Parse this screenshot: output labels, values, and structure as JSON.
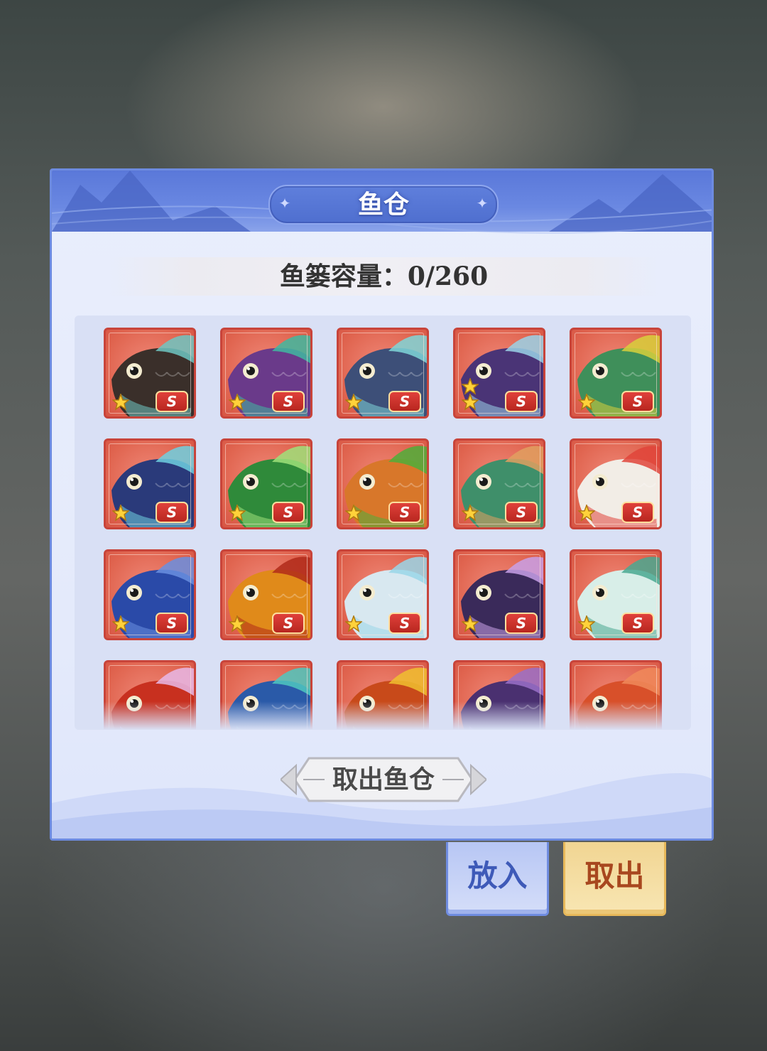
{
  "panel": {
    "title": "鱼仓",
    "capacity_text": "鱼篓容量：0/260",
    "take_storage_label": "取出鱼仓"
  },
  "actions": {
    "put_in_label": "放入",
    "take_out_label": "取出"
  },
  "fish_slots": [
    {
      "species": "black-dragon-fish",
      "body": "#3a2f2a",
      "accent": "#6fc6c2",
      "stars": 1,
      "badge": "S"
    },
    {
      "species": "purple-fish",
      "body": "#6a3a8a",
      "accent": "#3fb8a0",
      "stars": 1,
      "badge": "S"
    },
    {
      "species": "blue-spiky-fish",
      "body": "#3d4f78",
      "accent": "#7fd6d8",
      "stars": 1,
      "badge": "S"
    },
    {
      "species": "dark-purple-fish",
      "body": "#4a3476",
      "accent": "#9ad2e8",
      "stars": 2,
      "badge": "S"
    },
    {
      "species": "green-dragon-fish",
      "body": "#3f8f5a",
      "accent": "#d8d03c",
      "stars": 1,
      "badge": "S"
    },
    {
      "species": "anglerfish",
      "body": "#2a3a7a",
      "accent": "#6fd0e0",
      "stars": 1,
      "badge": "S"
    },
    {
      "species": "green-carp",
      "body": "#2f8a3a",
      "accent": "#9fe07a",
      "stars": 1,
      "badge": "S"
    },
    {
      "species": "orange-fish",
      "body": "#d8772a",
      "accent": "#4fae3a",
      "stars": 1,
      "badge": "S"
    },
    {
      "species": "green-antenna-fish",
      "body": "#3f8f6a",
      "accent": "#e0a060",
      "stars": 1,
      "badge": "S"
    },
    {
      "species": "white-red-goldfish",
      "body": "#f2ede6",
      "accent": "#e0443a",
      "stars": 1,
      "badge": "S"
    },
    {
      "species": "blue-fish",
      "body": "#2a4aa8",
      "accent": "#6a8fe0",
      "stars": 1,
      "badge": "S"
    },
    {
      "species": "golden-carp",
      "body": "#e08a1a",
      "accent": "#b02a1a",
      "stars": 1,
      "badge": "S"
    },
    {
      "species": "white-dragon-fish",
      "body": "#d8e8f0",
      "accent": "#9ad6e8",
      "stars": 1,
      "badge": "S"
    },
    {
      "species": "lavender-fish",
      "body": "#3a2a5a",
      "accent": "#c8a0e8",
      "stars": 1,
      "badge": "S"
    },
    {
      "species": "teal-spirit-fish",
      "body": "#d8eee8",
      "accent": "#4aa890",
      "stars": 1,
      "badge": "S"
    },
    {
      "species": "crowned-goldfish",
      "body": "#c8301f",
      "accent": "#e8b8e8",
      "stars": 0,
      "badge": ""
    },
    {
      "species": "horned-blue-fish",
      "body": "#2a5aa8",
      "accent": "#4fc8c0",
      "stars": 0,
      "badge": ""
    },
    {
      "species": "red-yellow-fish",
      "body": "#c84a1a",
      "accent": "#f0c030",
      "stars": 0,
      "badge": ""
    },
    {
      "species": "purple-angler-fish",
      "body": "#4a3070",
      "accent": "#9a70c8",
      "stars": 0,
      "badge": ""
    },
    {
      "species": "red-carp",
      "body": "#d8502a",
      "accent": "#f08a5a",
      "stars": 0,
      "badge": ""
    }
  ]
}
